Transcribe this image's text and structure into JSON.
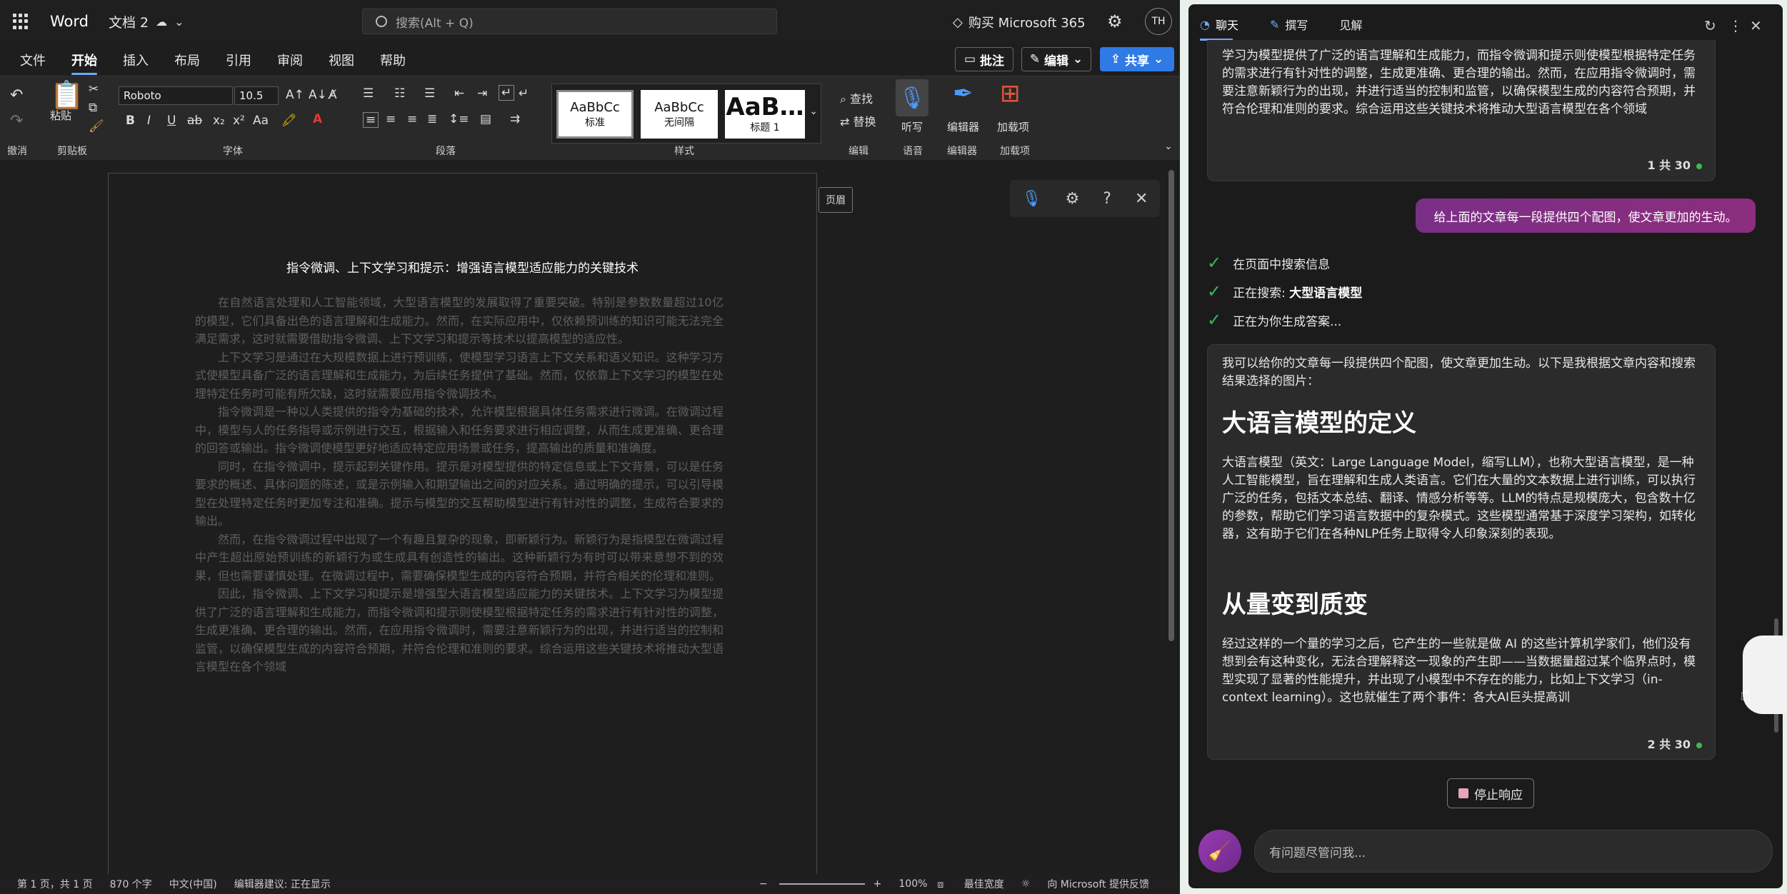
{
  "titlebar": {
    "app_name": "Word",
    "doc_name": "文档 2",
    "search_placeholder": "搜索(Alt + Q)",
    "buy_label": "购买 Microsoft 365",
    "avatar_initials": "TH"
  },
  "menu": {
    "items": [
      "文件",
      "开始",
      "插入",
      "布局",
      "引用",
      "审阅",
      "视图",
      "帮助"
    ],
    "active": "开始",
    "comment_label": "批注",
    "edit_label": "编辑",
    "share_label": "共享"
  },
  "ribbon": {
    "font_name": "Roboto",
    "font_size": "10.5",
    "paste_label": "粘贴",
    "group_labels": {
      "undo": "撤消",
      "clipboard": "剪贴板",
      "font": "字体",
      "paragraph": "段落",
      "styles": "样式",
      "edit": "编辑",
      "voice": "语音",
      "editor": "编辑器",
      "addins": "加载项"
    },
    "styles": [
      {
        "preview": "AaBbCc",
        "name": "标准"
      },
      {
        "preview": "AaBbCc",
        "name": "无间隔"
      },
      {
        "preview": "AaB…",
        "name": "标题 1"
      }
    ],
    "find_label": "查找",
    "replace_label": "替换",
    "dictate_label": "听写",
    "editor_label": "编辑器",
    "addins_label": "加载项"
  },
  "document": {
    "title": "指令微调、上下文学习和提示：增强语言模型适应能力的关键技术",
    "paragraphs": [
      "在自然语言处理和人工智能领域，大型语言模型的发展取得了重要突破。特别是参数数量超过10亿的模型，它们具备出色的语言理解和生成能力。然而，在实际应用中，仅依赖预训练的知识可能无法完全满足需求，这时就需要借助指令微调、上下文学习和提示等技术以提高模型的适应性。",
      "上下文学习是通过在大规模数据上进行预训练，使模型学习语言上下文关系和语义知识。这种学习方式使模型具备广泛的语言理解和生成能力，为后续任务提供了基础。然而，仅依靠上下文学习的模型在处理特定任务时可能有所欠缺，这时就需要应用指令微调技术。",
      "指令微调是一种以人类提供的指令为基础的技术，允许模型根据具体任务需求进行微调。在微调过程中，模型与人的任务指导或示例进行交互，根据输入和任务要求进行相应调整，从而生成更准确、更合理的回答或输出。指令微调使模型更好地适应特定应用场景或任务，提高输出的质量和准确度。",
      "同时，在指令微调中，提示起到关键作用。提示是对模型提供的特定信息或上下文背景，可以是任务要求的概述、具体问题的陈述，或是示例输入和期望输出之间的对应关系。通过明确的提示，可以引导模型在处理特定任务时更加专注和准确。提示与模型的交互帮助模型进行有针对性的调整，生成符合要求的输出。",
      "然而，在指令微调过程中出现了一个有趣且复杂的现象，即新颖行为。新颖行为是指模型在微调过程中产生超出原始预训练的新颖行为或生成具有创造性的输出。这种新颖行为有时可以带来意想不到的效果，但也需要谨慎处理。在微调过程中，需要确保模型生成的内容符合预期，并符合相关的伦理和准则。",
      "因此，指令微调、上下文学习和提示是增强型大语言模型适应能力的关键技术。上下文学习为模型提供了广泛的语言理解和生成能力，而指令微调和提示则使模型根据特定任务的需求进行有针对性的调整，生成更准确、更合理的输出。然而，在应用指令微调时，需要注意新颖行为的出现，并进行适当的控制和监管，以确保模型生成的内容符合预期，并符合伦理和准则的要求。综合运用这些关键技术将推动大型语言模型在各个领域"
    ],
    "header_tag": "页眉"
  },
  "statusbar": {
    "page": "第 1 页，共 1 页",
    "words": "870 个字",
    "lang": "中文(中国)",
    "editor": "编辑器建议: 正在显示",
    "zoom": "100%",
    "fit": "最佳宽度",
    "feedback": "向 Microsoft 提供反馈"
  },
  "copilot": {
    "tabs": [
      "聊天",
      "撰写",
      "见解"
    ],
    "card1_text": "学习为模型提供了广泛的语言理解和生成能力，而指令微调和提示则使模型根据特定任务的需求进行有针对性的调整，生成更准确、更合理的输出。然而，在应用指令微调时，需要注意新颖行为的出现，并进行适当的控制和监管，以确保模型生成的内容符合预期，并符合伦理和准则的要求。综合运用这些关键技术将推动大型语言模型在各个领域",
    "card1_count": "1 共 30",
    "user_message": "给上面的文章每一段提供四个配图，使文章更加的生动。",
    "steps": [
      "在页面中搜索信息",
      "正在搜索:",
      "正在为你生成答案..."
    ],
    "search_term": "大型语言模型",
    "answer_intro": "我可以给你的文章每一段提供四个配图，使文章更加生动。以下是我根据文章内容和搜索结果选择的图片：",
    "h1": "大语言模型的定义",
    "p1": "大语言模型（英文：Large Language Model，缩写LLM），也称大型语言模型，是一种人工智能模型，旨在理解和生成人类语言。它们在大量的文本数据上进行训练，可以执行广泛的任务，包括文本总结、翻译、情感分析等等。LLM的特点是规模庞大，包含数十亿的参数，帮助它们学习语言数据中的复杂模式。这些模型通常基于深度学习架构，如转化器，这有助于它们在各种NLP任务上取得令人印象深刻的表现。",
    "h2": "从量变到质变",
    "p2": "经过这样的一个量的学习之后，它产生的一些就是做 AI 的这些计算机学家们，他们没有想到会有这种变化，无法合理解释这一现象的产生即——当数据量超过某个临界点时，模型实现了显著的性能提升，并出现了小模型中不存在的能力，比如上下文学习（in-context learning）。这也就催生了两个事件：各大AI巨头提高训",
    "card2_count": "2 共 30",
    "stop_label": "停止响应",
    "ask_placeholder": "有问题尽管问我..."
  }
}
